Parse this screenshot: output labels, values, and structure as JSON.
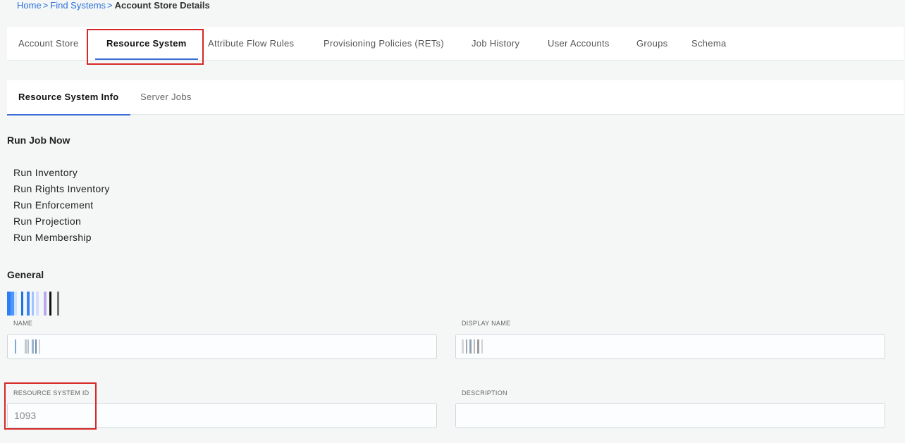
{
  "breadcrumb": {
    "home": "Home",
    "find_systems": "Find Systems",
    "current": "Account Store Details",
    "separator": ">"
  },
  "tabs": [
    {
      "label": "Account Store",
      "active": false
    },
    {
      "label": "Resource System",
      "active": true
    },
    {
      "label": "Attribute Flow Rules",
      "active": false
    },
    {
      "label": "Provisioning Policies (RETs)",
      "active": false
    },
    {
      "label": "Job History",
      "active": false
    },
    {
      "label": "User Accounts",
      "active": false
    },
    {
      "label": "Groups",
      "active": false
    },
    {
      "label": "Schema",
      "active": false
    }
  ],
  "subtabs": [
    {
      "label": "Resource System Info",
      "active": true
    },
    {
      "label": "Server Jobs",
      "active": false
    }
  ],
  "run_job": {
    "title": "Run Job Now",
    "items": [
      "Run Inventory",
      "Run Rights Inventory",
      "Run Enforcement",
      "Run Projection",
      "Run Membership"
    ]
  },
  "general": {
    "title": "General",
    "fields": {
      "name": {
        "label": "NAME",
        "value": ""
      },
      "display_name": {
        "label": "DISPLAY NAME",
        "value": ""
      },
      "resource_system_id": {
        "label": "RESOURCE SYSTEM ID",
        "value": "1093"
      },
      "description": {
        "label": "DESCRIPTION",
        "value": ""
      }
    }
  },
  "colors": {
    "accent": "#3a6fd8",
    "link": "#2f6fdb",
    "highlight": "#d62828",
    "background": "#f4f7f6"
  }
}
